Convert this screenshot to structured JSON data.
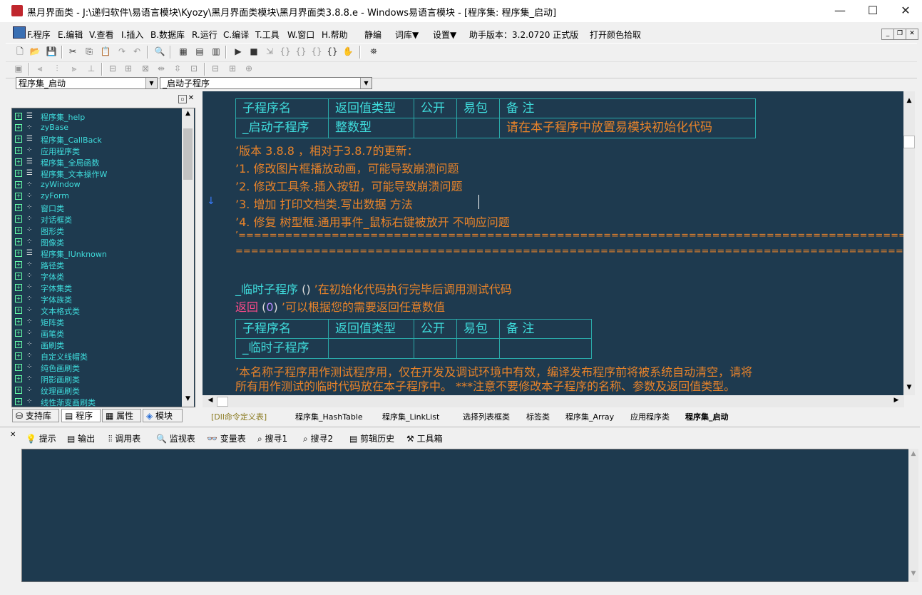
{
  "window": {
    "title": "黑月界面类 - J:\\递归软件\\易语言模块\\Kyozy\\黑月界面类模块\\黑月界面类3.8.8.e - Windows易语言模块 - [程序集: 程序集_启动]",
    "minimize": "—",
    "maximize": "☐",
    "close": "✕"
  },
  "menu": {
    "items": [
      "F.程序",
      "E.编辑",
      "V.查看",
      "I.插入",
      "B.数据库",
      "R.运行",
      "C.编译",
      "T.工具",
      "W.窗口",
      "H.帮助",
      "静编",
      "词库▼",
      "设置▼",
      "助手版本：3.2.0720 正式版",
      "打开颜色拾取"
    ]
  },
  "combos": {
    "assembly": "程序集_启动",
    "subprogram": "_启动子程序"
  },
  "tree": {
    "items": [
      "程序集_help",
      "zyBase",
      "程序集_CallBack",
      "应用程序类",
      "程序集_全局函数",
      "程序集_文本操作W",
      "zyWindow",
      "zyForm",
      "窗口类",
      "对话框类",
      "图形类",
      "图像类",
      "程序集_IUnknown",
      "路径类",
      "字体类",
      "字体集类",
      "字体族类",
      "文本格式类",
      "矩阵类",
      "画笔类",
      "画刷类",
      "自定义线帽类",
      "纯色画刷类",
      "阴影画刷类",
      "纹理画刷类",
      "线性渐变画刷类"
    ]
  },
  "left_tabs": [
    "支持库",
    "程序",
    "属性",
    "模块"
  ],
  "editor": {
    "table1": {
      "headers": [
        "子程序名",
        "返回值类型",
        "公开",
        "易包",
        "备 注"
      ],
      "row": [
        "_启动子程序",
        "整数型",
        "",
        "",
        "请在本子程序中放置易模块初始化代码"
      ]
    },
    "comments": [
      "’版本 3.8.8 ，相对于3.8.7的更新：",
      "’1. 修改图片框播放动画，可能导致崩溃问题",
      "’2. 修改工具条.插入按钮，可能导致崩溃问题",
      "’3. 增加 打印文档类.写出数据 方法",
      "’4. 修复 树型框.通用事件_鼠标右键被放开 不响应问题",
      "’==========================================================================================",
      "========================================================================================"
    ],
    "call_line": {
      "name": "_临时子程序",
      "parens": " () ",
      "comment": "’在初始化代码执行完毕后调用测试代码"
    },
    "return_line": {
      "keyword": "返回",
      "open": " (",
      "value": "0",
      "close": ") ",
      "comment": "’可以根据您的需要返回任意数值"
    },
    "table2": {
      "headers": [
        "子程序名",
        "返回值类型",
        "公开",
        "易包",
        "备 注"
      ],
      "row": [
        "_临时子程序",
        "",
        "",
        "",
        ""
      ]
    },
    "note_line1": "’本名称子程序用作测试程序用，仅在开发及调试环境中有效，编译发布程序前将被系统自动清空，请将",
    "note_line2": "所有用作测试的临时代码放在本子程序中。 ***注意不要修改本子程序的名称、参数及返回值类型。"
  },
  "file_tabs": [
    "[Dll命令定义表]",
    "程序集_HashTable",
    "程序集_LinkList",
    "选择列表框类",
    "标签类",
    "程序集_Array",
    "应用程序类",
    "程序集_启动"
  ],
  "bottom_tabs": [
    "提示",
    "输出",
    "调用表",
    "监视表",
    "变量表",
    "搜寻1",
    "搜寻2",
    "剪辑历史",
    "工具箱"
  ]
}
